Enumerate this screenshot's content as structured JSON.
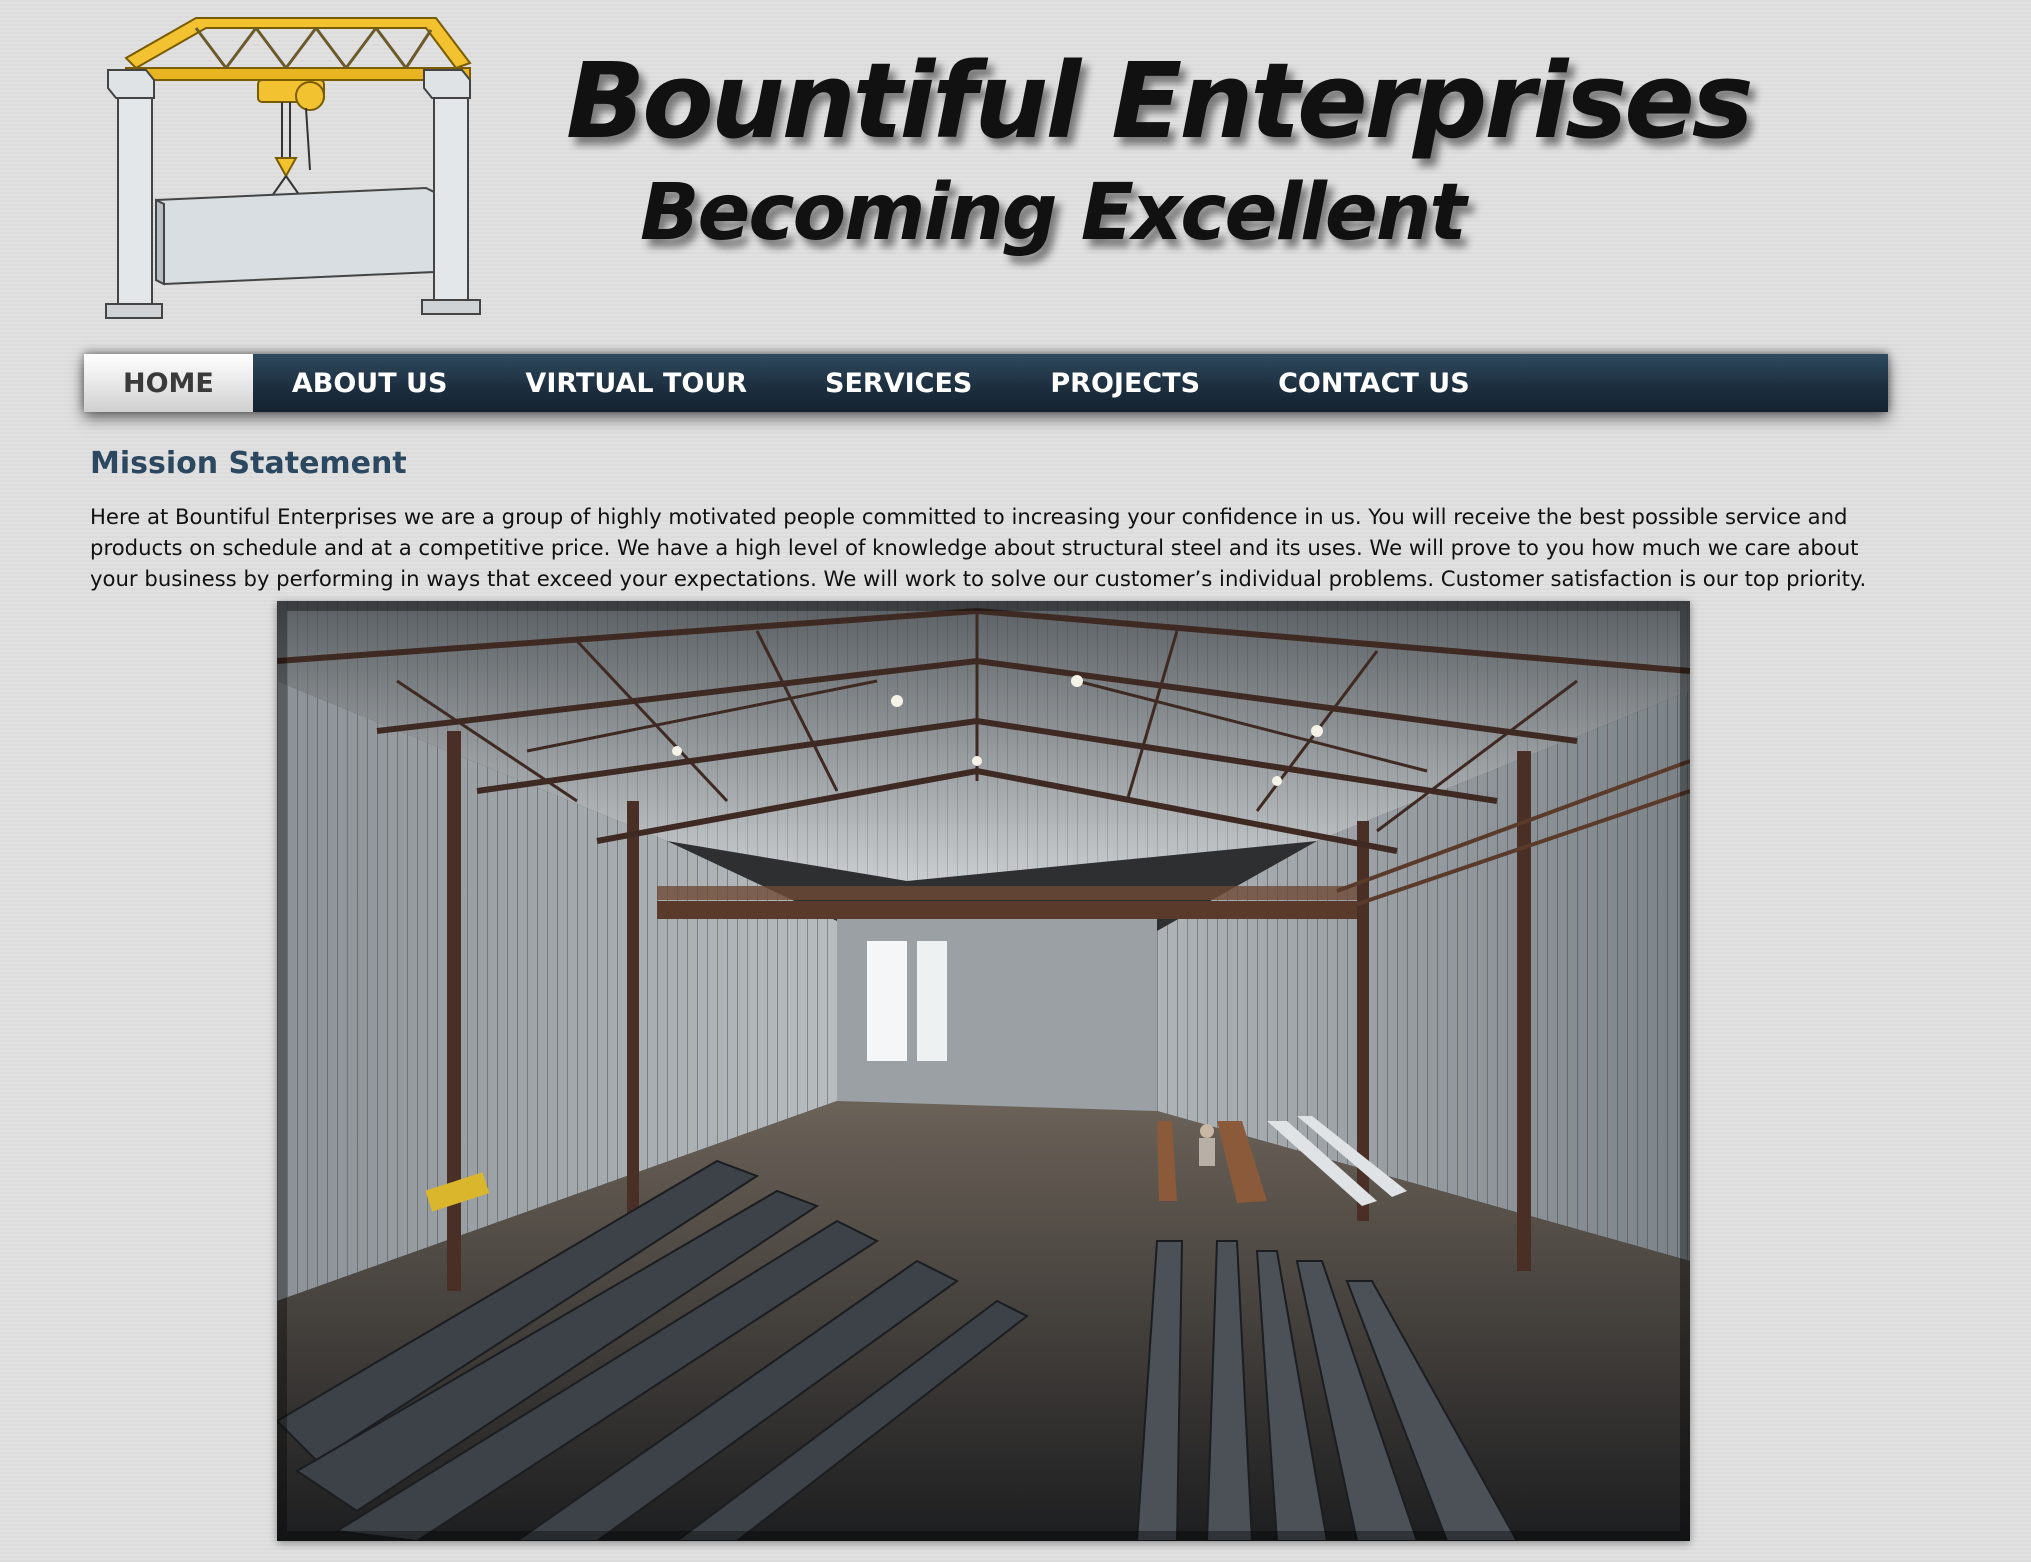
{
  "brand": {
    "title": "Bountiful Enterprises",
    "tagline": "Becoming Excellent"
  },
  "nav": {
    "items": [
      {
        "label": "HOME",
        "active": true
      },
      {
        "label": "ABOUT US",
        "active": false
      },
      {
        "label": "VIRTUAL TOUR",
        "active": false
      },
      {
        "label": "SERVICES",
        "active": false
      },
      {
        "label": "PROJECTS",
        "active": false
      },
      {
        "label": "CONTACT US",
        "active": false
      }
    ]
  },
  "mission": {
    "heading": "Mission Statement",
    "text": "Here at Bountiful Enterprises we are a group of highly motivated people committed to increasing your confidence in us. You will receive the best possible service and products on schedule and at a competitive price. We have a high level of knowledge about structural steel and its uses. We will prove to you how much we care about your business by performing in ways that exceed your expectations. We will work to solve our customer’s individual problems. Customer satisfaction is our top priority."
  },
  "colors": {
    "nav_bg": "#1c2e3e",
    "heading": "#2b4860",
    "crane_yellow": "#f2c230",
    "active_tab_text": "#3a3a3a"
  },
  "icons": {
    "logo": "gantry-crane-logo",
    "photo": "warehouse-interior-photo"
  }
}
